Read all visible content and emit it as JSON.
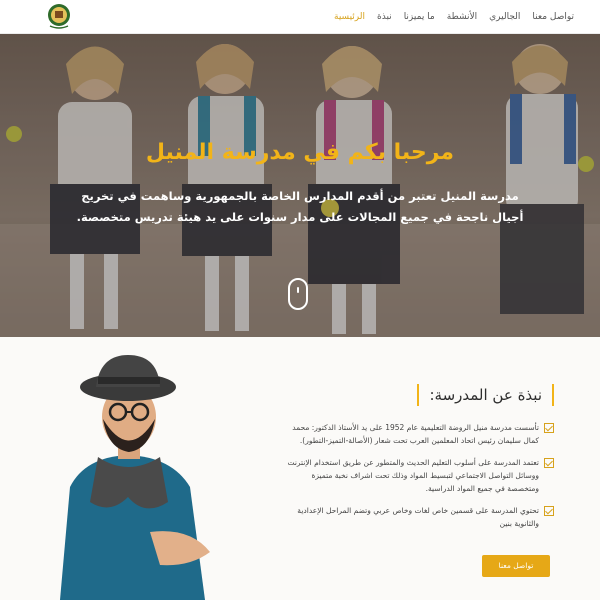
{
  "nav": {
    "items": [
      {
        "label": "الرئيسية",
        "active": true
      },
      {
        "label": "نبذة",
        "active": false
      },
      {
        "label": "ما يميزنا",
        "active": false
      },
      {
        "label": "الأنشطة",
        "active": false
      },
      {
        "label": "الجاليري",
        "active": false
      },
      {
        "label": "تواصل معنا",
        "active": false
      }
    ],
    "logo_icon": "school-crest-logo"
  },
  "hero": {
    "title": "مرحبا بكم في مدرسة المنيل",
    "text": "مدرسة المنيل تعتبر من أقدم المدارس الخاصة بالجمهورية وساهمت في تخريج أجيال ناجحة في جميع المجالات على مدار سنوات على يد هيئة تدريس متخصصة."
  },
  "about": {
    "title": "نبذة عن المدرسة:",
    "items": [
      "تأسست مدرسة منيل الروضة التعليمية عام 1952 على يد الأستاذ الدكتور: محمد كمال سليمان رئيس اتحاد المعلمين العرب تحت شعار (الأصالة-التميز-التطور).",
      "تعتمد المدرسة على أسلوب التعليم الحديث والمتطور عن طريق استخدام الإنترنت ووسائل التواصل الاجتماعي لتبسيط المواد وذلك تحت اشراف نخبة متميزة ومتخصصة في جميع المواد الدراسية.",
      "تحتوي المدرسة على قسمين خاص لغات وخاص عربي وتضم المراحل الإعدادية والثانوية بنين"
    ],
    "cta_label": "تواصل معنا"
  },
  "colors": {
    "accent": "#e6a817",
    "title_gold": "#f2b418"
  }
}
